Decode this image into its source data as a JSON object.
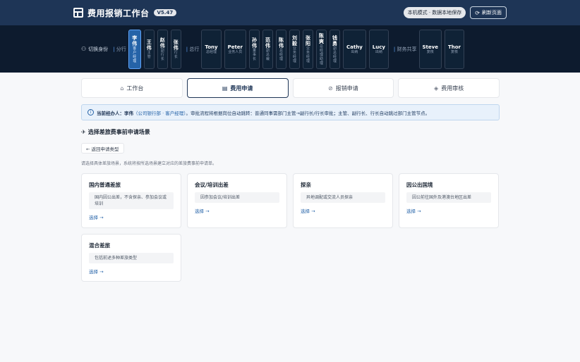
{
  "header": {
    "title": "费用报销工作台",
    "version": "V5.47",
    "mode_label": "本机模式 · 数据本地保存",
    "refresh_label": "刷新页面"
  },
  "rolebar": {
    "switch_label": "切换身份",
    "groups": [
      {
        "label": "分行"
      },
      {
        "label": "总行"
      },
      {
        "label": "财务共享"
      }
    ],
    "roles": [
      {
        "name": "李伟",
        "role": "客户经理",
        "active": true
      },
      {
        "name": "王伟",
        "role": "主管"
      },
      {
        "name": "赵伟",
        "role": "副行长"
      },
      {
        "name": "张伟",
        "role": "行长"
      },
      {
        "name": "Tony",
        "role": "总经理"
      },
      {
        "name": "Peter",
        "role": "业务人员"
      },
      {
        "name": "孙伟",
        "role": "董事长"
      },
      {
        "name": "范伟",
        "role": "副总裁"
      },
      {
        "name": "陈伟",
        "role": "总经理"
      },
      {
        "name": "刘毅",
        "role": "业务经理"
      },
      {
        "name": "张阳",
        "role": "业务经理"
      },
      {
        "name": "陈爽",
        "role": "总经理助理"
      },
      {
        "name": "钱勇",
        "role": "副总经理"
      },
      {
        "name": "Cathy",
        "role": "出纳"
      },
      {
        "name": "Lucy",
        "role": "出纳"
      },
      {
        "name": "Steve",
        "role": "复核"
      },
      {
        "name": "Thor",
        "role": "复核"
      }
    ]
  },
  "tabs": [
    {
      "label": "工作台",
      "icon": "home-icon"
    },
    {
      "label": "费用申请",
      "icon": "document-icon",
      "active": true
    },
    {
      "label": "报销申请",
      "icon": "check-circle-icon"
    },
    {
      "label": "费用审核",
      "icon": "stack-icon"
    }
  ],
  "info": {
    "prefix": "当前经办人：",
    "name": "李伟",
    "who": "（公司银行部 · 客户经理）",
    "text": "。审批流程将根据岗位自动跳转：普通同事需部门主管→副行长/行长审批；主管、副行长、行长自动跳过部门主管节点。"
  },
  "section_title": "选择差旅费事前申请场景",
  "back_label": "← 返回申请类型",
  "hint": "请选择具体差旅场景，系统将按所选场景建立对应的差旅费事前申请单。",
  "cards": [
    {
      "title": "国内普通差旅",
      "desc": "国内因公出差，不含探亲、参加会议或培训",
      "select": "选择 →"
    },
    {
      "title": "会议/培训出差",
      "desc": "因参加会议/培训出差",
      "select": "选择 →"
    },
    {
      "title": "探亲",
      "desc": "异地调配或交流人员探亲",
      "select": "选择 →"
    },
    {
      "title": "因公出国境",
      "desc": "因公前往国外及港澳台地区出差",
      "select": "选择 →"
    },
    {
      "title": "混合差旅",
      "desc": "包括前述多种差旅类型",
      "select": "选择 →"
    }
  ],
  "colors": {
    "header_bg": "#1e3556",
    "rolebar_bg": "#0d1b2e",
    "accent": "#2563a8"
  }
}
